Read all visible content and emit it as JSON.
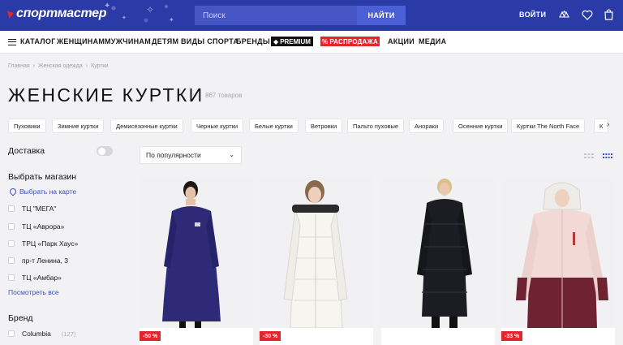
{
  "header": {
    "logo": "спортмастер",
    "search_placeholder": "Поиск",
    "search_button": "НАЙТИ",
    "login": "ВОЙТИ",
    "icons": [
      "compare-icon",
      "heart-icon",
      "bag-icon"
    ]
  },
  "nav": {
    "catalog": "КАТАЛОГ",
    "items": [
      "ЖЕНЩИНАМ",
      "МУЖЧИНАМ",
      "ДЕТЯМ",
      "ВИДЫ СПОРТА",
      "БРЕНДЫ"
    ],
    "premium": "PREMIUM",
    "sale": "РАСПРОДАЖА",
    "extra": [
      "АКЦИИ",
      "МЕДИА"
    ]
  },
  "breadcrumb": [
    "Главная",
    "Женская одежда",
    "Куртки"
  ],
  "title": "ЖЕНСКИЕ КУРТКИ",
  "goods_count": "867 товаров",
  "chips": [
    "Пуховики",
    "Зимние куртки",
    "Демисезонные куртки",
    "Черные куртки",
    "Белые куртки",
    "Ветровки",
    "Пальто пуховые",
    "Анораки",
    "Осенние куртки",
    "Куртки The North Face",
    "К"
  ],
  "sidebar": {
    "delivery": "Доставка",
    "choose_store": "Выбрать магазин",
    "map_link": "Выбрать на карте",
    "stores": [
      "ТЦ \"МЕГА\"",
      "ТЦ «Аврора»",
      "ТРЦ «Парк Хаус»",
      "пр-т Ленина, 3",
      "ТЦ «Амбар»"
    ],
    "see_all": "Посмотреть все",
    "brand_heading": "Бренд",
    "brand_first": "Columbia",
    "brand_first_count": "(127)"
  },
  "sort": {
    "selected": "По популярности"
  },
  "products": [
    {
      "discount": "-50 %",
      "color": "#2e2a78"
    },
    {
      "discount": "-30 %",
      "color": "#f4f3ee"
    },
    {
      "discount": "",
      "color": "#1c1d22"
    },
    {
      "discount": "-33 %",
      "color": "#f2d9d5"
    }
  ],
  "colors": {
    "brand": "#2a3ba8",
    "accent": "#e3262b",
    "link": "#3a4fc8"
  }
}
